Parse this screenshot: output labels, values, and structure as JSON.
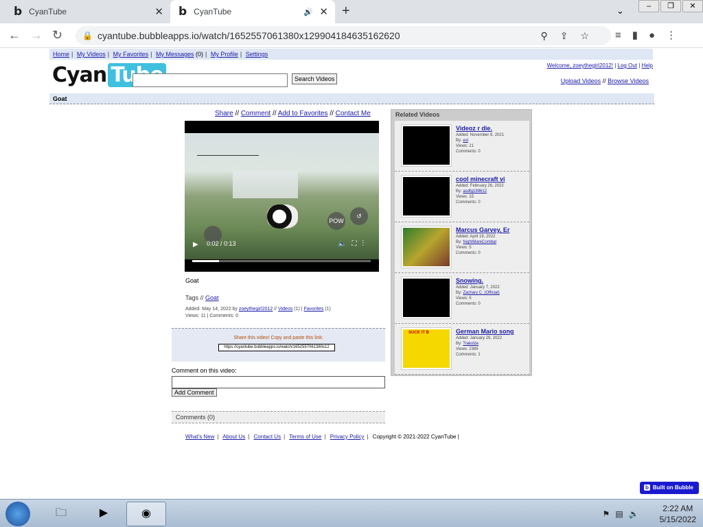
{
  "browser": {
    "tabs": [
      {
        "title": "CyanTube"
      },
      {
        "title": "CyanTube"
      }
    ],
    "url": "cyantube.bubbleapps.io/watch/1652557061380x129904184635162620"
  },
  "site": {
    "topnav": [
      "Home",
      "My Videos",
      "My Favorites",
      "My Messages",
      "(0)",
      "My Profile",
      "Settings"
    ],
    "logo_left": "Cyan",
    "logo_right": "Tube",
    "search_button": "Search Videos",
    "welcome": "Welcome, zoeythegirl2012!",
    "logout": "Log Out",
    "help": "Help",
    "upload": "Upload Videos",
    "browse": "Browse Videos",
    "breadcrumb": "Goat"
  },
  "video": {
    "share": "Share",
    "comment": "Comment",
    "add_fav": "Add to Favorites",
    "contact": "Contact Me",
    "time": "0:02 / 0:13",
    "progress": 0.15,
    "title": "Goat",
    "tags_label": "Tags //",
    "tag": "Goat",
    "added_prefix": "Added: May 14, 2022 by",
    "author": "zoeythegirl2012",
    "videos_link": "Videos",
    "videos_count": "(1)",
    "favorites_link": "Favorites",
    "favorites_count": "(1)",
    "stats": "Views: 11 | Comments: 0",
    "share_label": "Share this video! Copy and paste this link:",
    "share_url": "https://cyantube.bubbleapps.io/watch/1652557061380x12",
    "comment_label": "Comment on this video:",
    "add_comment_button": "Add Comment",
    "comments_header": "Comments (0)"
  },
  "related": {
    "header": "Related Videos",
    "items": [
      {
        "title": "Videoz r die.",
        "added": "Added: November 8, 2021",
        "by_label": "By:",
        "by": "esl",
        "views": "Views: 21",
        "comments": "Comments: 0"
      },
      {
        "title": "cool minecraft vi",
        "added": "Added: February 26, 2022",
        "by_label": "By:",
        "by": "asdfg199612",
        "views": "Views: 15",
        "comments": "Comments: 0"
      },
      {
        "title": "Marcus Garvey, Er",
        "added": "Added: April 19, 2022",
        "by_label": "By:",
        "by": "NightMareCombat",
        "views": "Views: 5",
        "comments": "Comments: 0"
      },
      {
        "title": "Snowing.",
        "added": "Added: January 7, 2022",
        "by_label": "By:",
        "by": "Zachary C. (Official)",
        "views": "Views: 5",
        "comments": "Comments: 0"
      },
      {
        "title": "German Mario song",
        "added": "Added: January 29, 2022",
        "by_label": "By:",
        "by": "Trakolze",
        "views": "Views: 2389",
        "comments": "Comments: 1"
      }
    ]
  },
  "footer": {
    "links": [
      "What's New",
      "About Us",
      "Contact Us",
      "Terms of Use",
      "Privacy Policy"
    ],
    "copyright": "Copyright © 2021-2022 CyanTube |"
  },
  "badge": {
    "icon": "b",
    "label": "Built on Bubble"
  },
  "taskbar": {
    "time": "2:22 AM",
    "date": "5/15/2022"
  }
}
